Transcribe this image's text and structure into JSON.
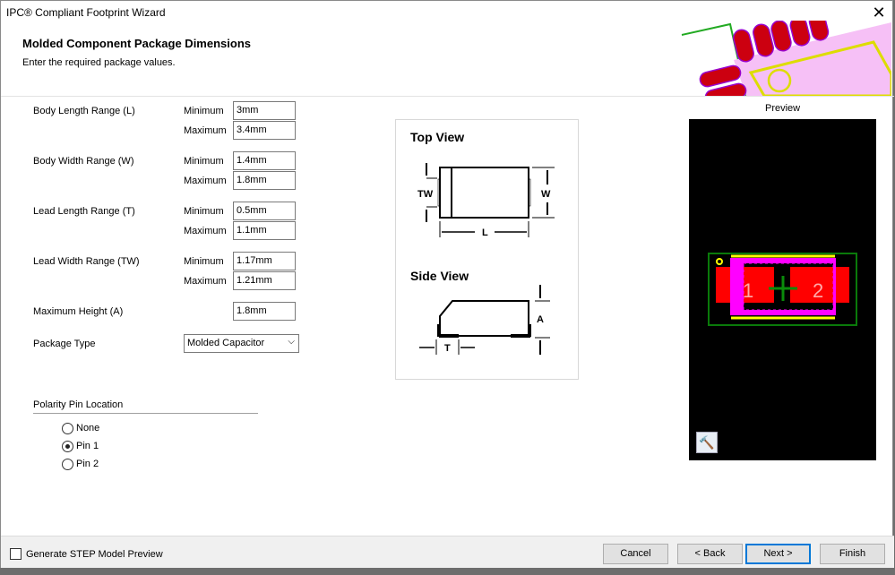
{
  "window": {
    "title": "IPC® Compliant Footprint Wizard",
    "close_icon": "close-icon"
  },
  "header": {
    "title": "Molded Component Package Dimensions",
    "subtitle": "Enter the required package values."
  },
  "fields": [
    {
      "label": "Body Length Range (L)",
      "min_label": "Minimum",
      "min": "3mm",
      "max_label": "Maximum",
      "max": "3.4mm"
    },
    {
      "label": "Body Width Range (W)",
      "min_label": "Minimum",
      "min": "1.4mm",
      "max_label": "Maximum",
      "max": "1.8mm"
    },
    {
      "label": "Lead Length Range (T)",
      "min_label": "Minimum",
      "min": "0.5mm",
      "max_label": "Maximum",
      "max": "1.1mm"
    },
    {
      "label": "Lead Width Range (TW)",
      "min_label": "Minimum",
      "min": "1.17mm",
      "max_label": "Maximum",
      "max": "1.21mm"
    }
  ],
  "max_height": {
    "label": "Maximum Height (A)",
    "value": "1.8mm"
  },
  "package_type": {
    "label": "Package Type",
    "value": "Molded Capacitor"
  },
  "polarity": {
    "label": "Polarity Pin Location",
    "options": [
      "None",
      "Pin 1",
      "Pin 2"
    ],
    "selected": "Pin 1"
  },
  "diagram": {
    "top_view": "Top View",
    "side_view": "Side View",
    "labels": {
      "tw": "TW",
      "w": "W",
      "l": "L",
      "a": "A",
      "t": "T"
    }
  },
  "preview": {
    "label": "Preview",
    "pad_labels": [
      "1",
      "2"
    ]
  },
  "footer": {
    "step_label": "Generate STEP Model Preview",
    "cancel": "Cancel",
    "back": "< Back",
    "next": "Next >",
    "finish": "Finish"
  }
}
